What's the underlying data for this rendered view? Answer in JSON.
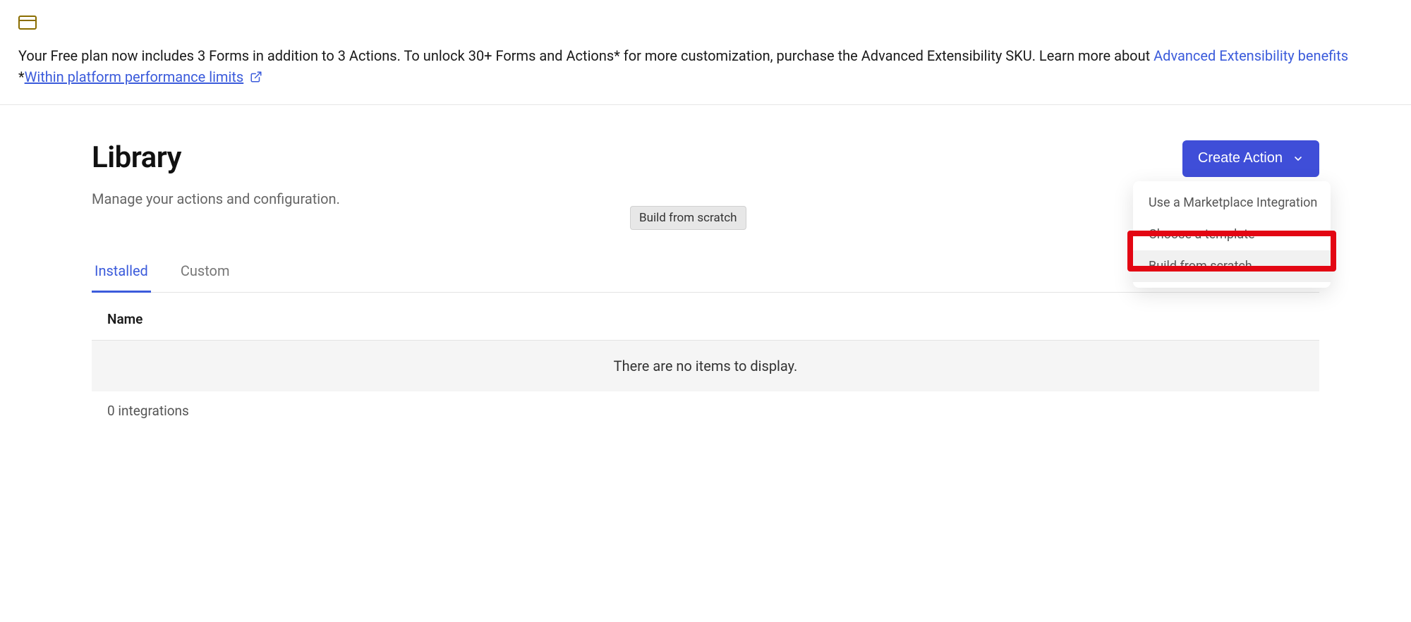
{
  "banner": {
    "text_1": "Your Free plan now includes 3 Forms in addition to 3 Actions. To unlock 30+ Forms and Actions* for more customization, purchase the Advanced Extensibility SKU. Learn more about ",
    "link_benefits": "Advanced Extensibility benefits",
    "asterisk": "*",
    "link_limits": "Within platform performance limits"
  },
  "page": {
    "title": "Library",
    "subtitle": "Manage your actions and configuration."
  },
  "create_button": {
    "label": "Create Action"
  },
  "dropdown": {
    "items": [
      {
        "label": "Use a Marketplace Integration"
      },
      {
        "label": "Choose a template"
      },
      {
        "label": "Build from scratch"
      }
    ]
  },
  "tooltip": {
    "text": "Build from scratch"
  },
  "tabs": {
    "installed": "Installed",
    "custom": "Custom"
  },
  "table": {
    "col_name": "Name",
    "empty": "There are no items to display.",
    "footer": "0 integrations"
  }
}
